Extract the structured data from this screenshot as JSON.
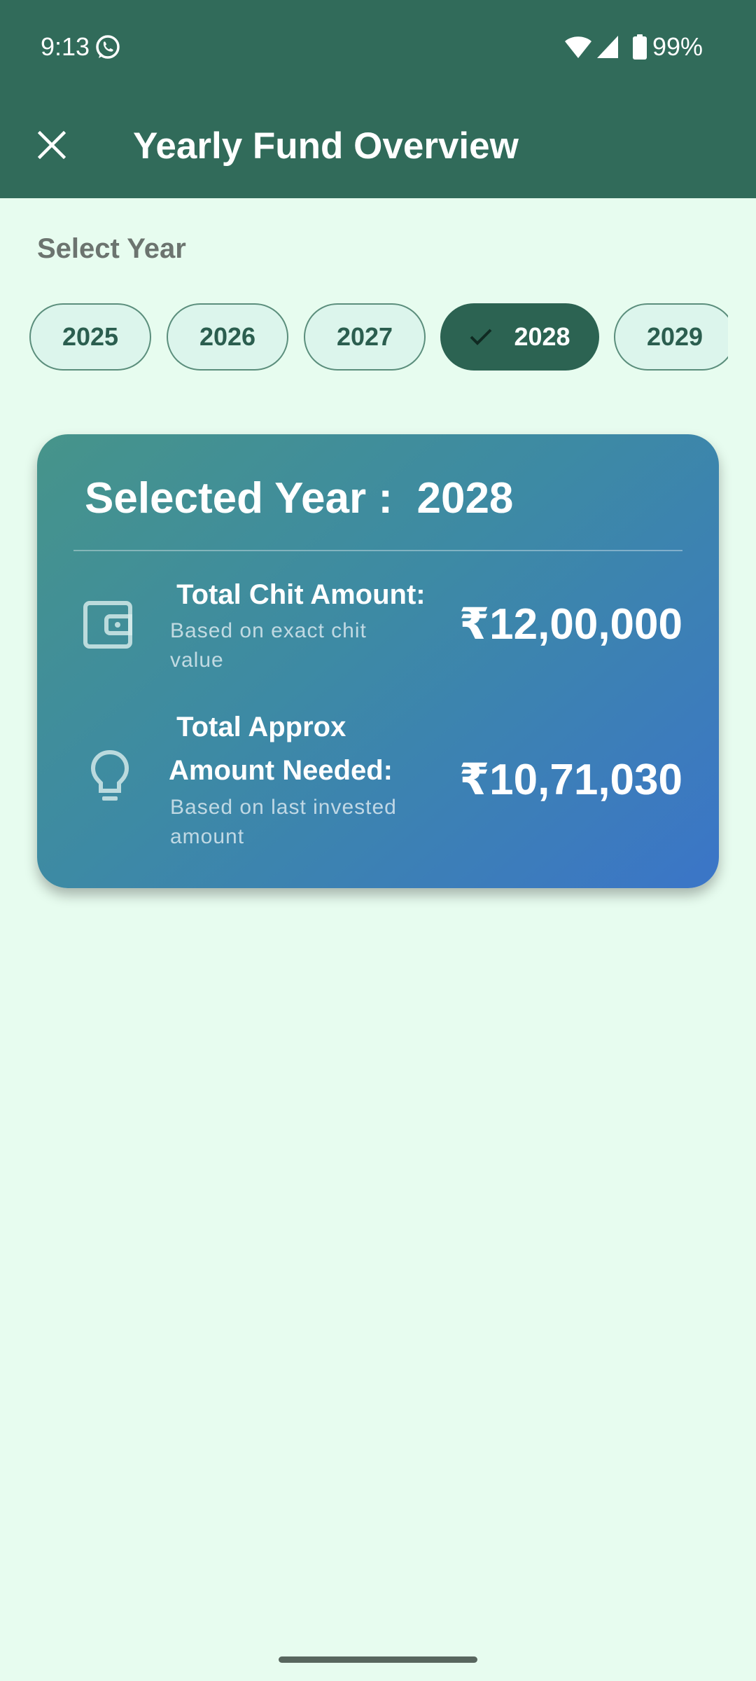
{
  "status_bar": {
    "time": "9:13",
    "battery": "99%",
    "icons": [
      "whatsapp-icon",
      "wifi-icon",
      "signal-icon",
      "battery-icon"
    ]
  },
  "toolbar": {
    "title": "Yearly Fund Overview",
    "close_icon": "close-icon"
  },
  "year_selector": {
    "label": "Select Year",
    "years": [
      "2025",
      "2026",
      "2027",
      "2028",
      "2029"
    ],
    "selected": "2028"
  },
  "summary": {
    "title": "Selected Year :  2028",
    "rows": [
      {
        "icon": "wallet-icon",
        "label": " Total Chit Amount:",
        "sub": "Based on exact chit value",
        "amount": "₹12,00,000"
      },
      {
        "icon": "lightbulb-icon",
        "label": " Total Approx Amount Needed:",
        "sub": "Based on last invested amount",
        "amount": "₹10,71,030"
      }
    ]
  },
  "colors": {
    "app_bar": "#316b5a",
    "background": "#e7fcef",
    "chip_selected": "#2c6352",
    "chip_default": "#dcf5ec",
    "card_gradient_start": "#46948a",
    "card_gradient_end": "#3b75c8"
  }
}
